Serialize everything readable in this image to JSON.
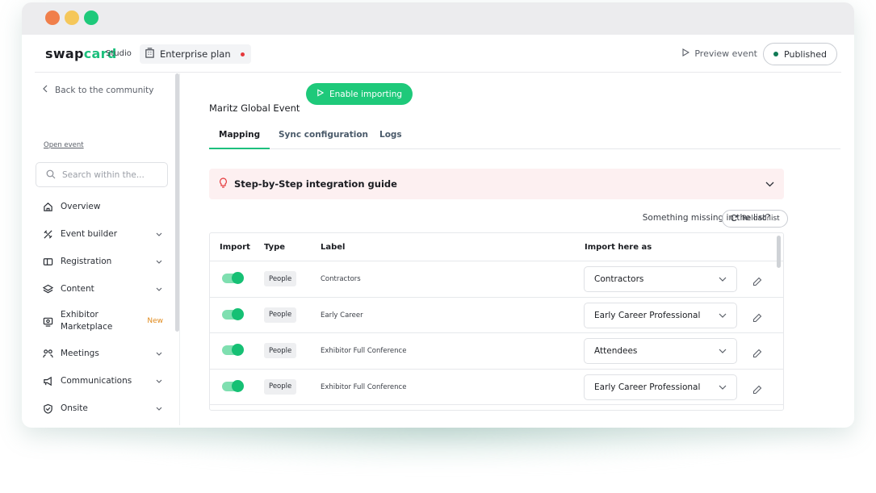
{
  "window": {
    "controls": [
      "close",
      "minimize",
      "maximize"
    ]
  },
  "header": {
    "logo_part1": "swap",
    "logo_part2": "card",
    "studio_label": "Studio",
    "plan_label": "Enterprise plan",
    "preview_label": "Preview event",
    "published_label": "Published"
  },
  "sidebar": {
    "back_label": "Back to the community",
    "open_event_label": "Open event",
    "search_placeholder": "Search within the...",
    "items": [
      {
        "label": "Overview",
        "icon": "home-icon",
        "chevron": false
      },
      {
        "label": "Event builder",
        "icon": "tools-icon",
        "chevron": true
      },
      {
        "label": "Registration",
        "icon": "ticket-icon",
        "chevron": true
      },
      {
        "label": "Content",
        "icon": "layers-icon",
        "chevron": true
      },
      {
        "label": "Exhibitor Marketplace",
        "icon": "marketplace-icon",
        "badge": "New"
      },
      {
        "label": "Meetings",
        "icon": "meetings-icon",
        "chevron": true
      },
      {
        "label": "Communications",
        "icon": "megaphone-icon",
        "chevron": true
      },
      {
        "label": "Onsite",
        "icon": "onsite-icon",
        "chevron": true
      }
    ]
  },
  "main": {
    "event_title": "Maritz Global Event",
    "enable_label": "Enable importing",
    "tabs": [
      "Mapping",
      "Sync configuration",
      "Logs"
    ],
    "guide_label": "Step-by-Step integration guide",
    "missing_label": "Something missing in the list?",
    "reload_label": "Reload list",
    "table": {
      "headers": [
        "Import",
        "Type",
        "Label",
        "Import here as"
      ],
      "rows": [
        {
          "type": "People",
          "label": "Contractors",
          "import_as": "Contractors"
        },
        {
          "type": "People",
          "label": "Early Career",
          "import_as": "Early Career Professional"
        },
        {
          "type": "People",
          "label": "Exhibitor Full Conference",
          "import_as": "Attendees"
        },
        {
          "type": "People",
          "label": "Exhibitor Full Conference",
          "import_as": "Early Career Professional"
        }
      ]
    }
  },
  "colors": {
    "brand_green": "#1ec97a",
    "guide_bg": "#fdf0f1",
    "new_badge": "#e08a1c",
    "status_red": "#e5383b"
  }
}
